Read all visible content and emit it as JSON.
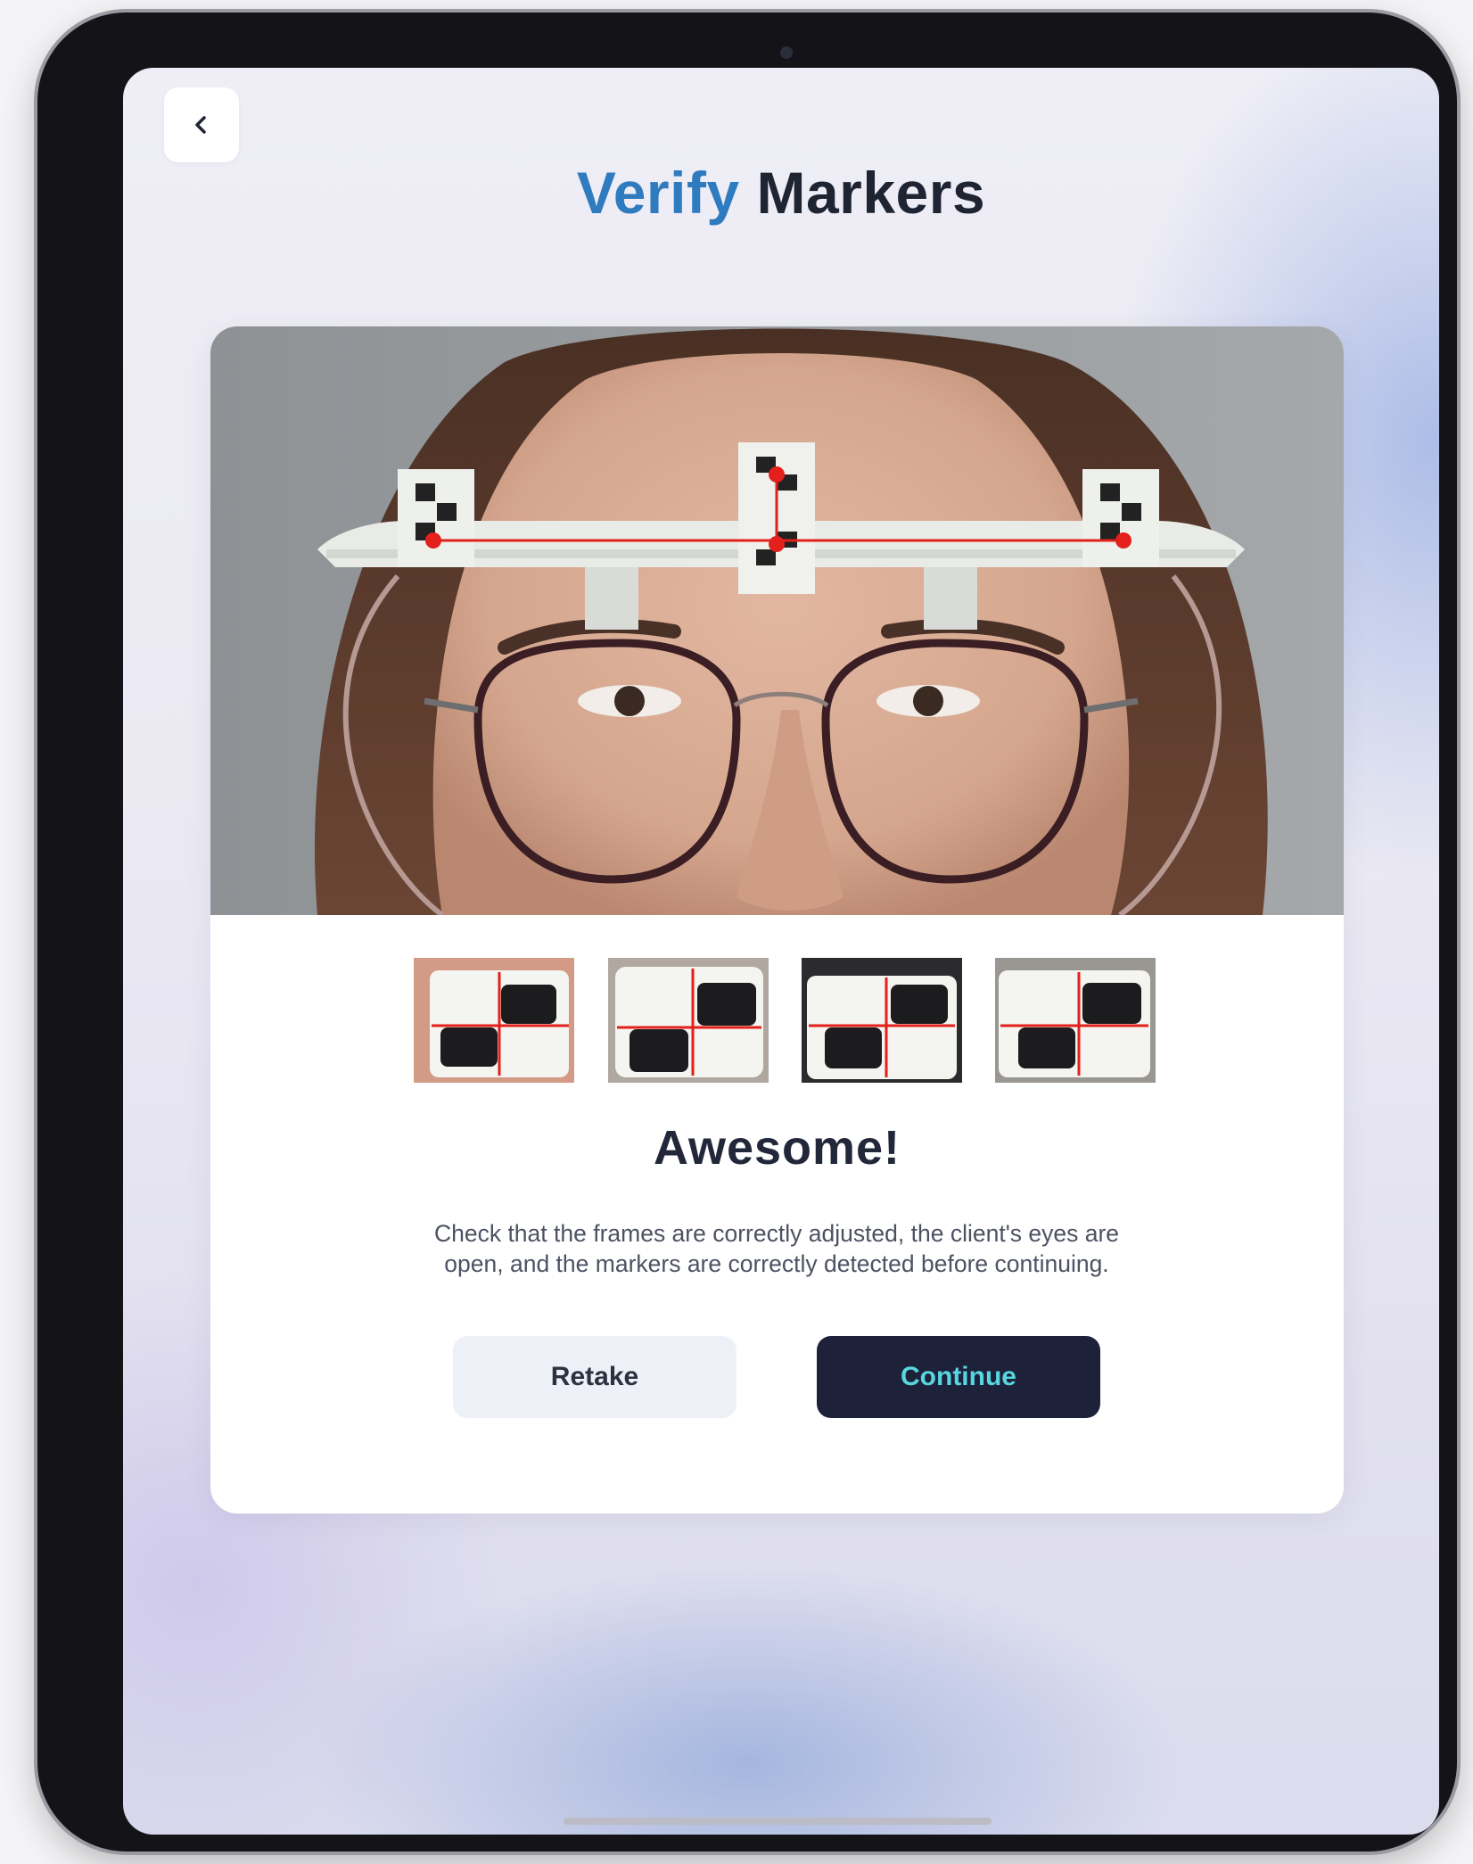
{
  "header": {
    "back_icon": "chevron-left-icon",
    "title_accent": "Verify",
    "title_rest": "Markers",
    "accent_color": "#2f7bbf"
  },
  "photo": {
    "subject": "face-with-measurement-clip",
    "marker_color": "#e3201b"
  },
  "thumbnails": [
    {
      "name": "marker-left"
    },
    {
      "name": "marker-center-top"
    },
    {
      "name": "marker-center-bottom"
    },
    {
      "name": "marker-right"
    }
  ],
  "result": {
    "heading": "Awesome!",
    "description": "Check that the frames are correctly adjusted, the client's eyes are open, and the markers are correctly detected before continuing."
  },
  "actions": {
    "retake_label": "Retake",
    "continue_label": "Continue",
    "continue_bg": "#1d2139",
    "continue_text_color": "#58d6e0"
  }
}
